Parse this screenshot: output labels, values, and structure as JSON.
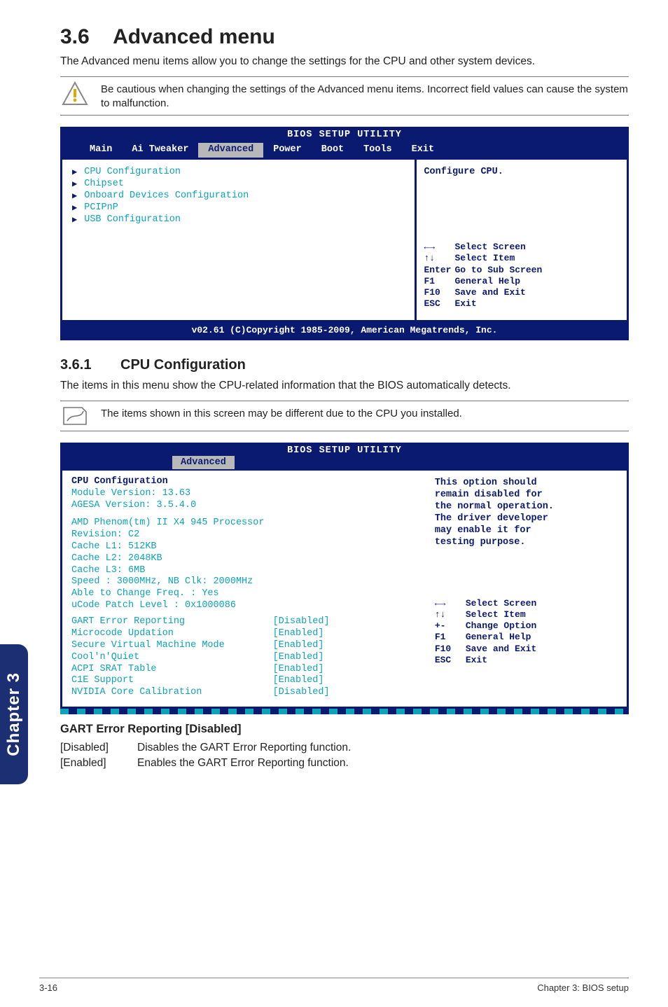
{
  "section": {
    "number": "3.6",
    "title": "Advanced menu"
  },
  "intro": "The Advanced menu items allow you to change the settings for the CPU and other system devices.",
  "warning": "Be cautious when changing the settings of the Advanced menu items. Incorrect field values can cause the system to malfunction.",
  "bios1": {
    "title": "BIOS SETUP UTILITY",
    "tabs": [
      "Main",
      "Ai Tweaker",
      "Advanced",
      "Power",
      "Boot",
      "Tools",
      "Exit"
    ],
    "selected_tab": "Advanced",
    "menu_items": [
      "CPU Configuration",
      "Chipset",
      "Onboard Devices Configuration",
      "PCIPnP",
      "USB Configuration"
    ],
    "help_title": "Configure CPU.",
    "help_keys": [
      {
        "k": "←→",
        "v": "Select Screen"
      },
      {
        "k": "↑↓",
        "v": "Select Item"
      },
      {
        "k": "Enter",
        "v": "Go to Sub Screen"
      },
      {
        "k": "F1",
        "v": "General Help"
      },
      {
        "k": "F10",
        "v": "Save and Exit"
      },
      {
        "k": "ESC",
        "v": "Exit"
      }
    ],
    "footer": "v02.61 (C)Copyright 1985-2009, American Megatrends, Inc."
  },
  "subsection": {
    "number": "3.6.1",
    "title": "CPU Configuration"
  },
  "sub_intro": "The items in this menu show the CPU-related information that the BIOS automatically detects.",
  "note": "The items shown in this screen may be different due to the CPU you installed.",
  "bios2": {
    "title": "BIOS SETUP UTILITY",
    "tab": "Advanced",
    "header": "CPU Configuration",
    "info_lines": [
      "Module Version: 13.63",
      "AGESA Version: 3.5.4.0"
    ],
    "cpu_lines": [
      "AMD Phenom(tm) II X4 945 Processor",
      "Revision: C2",
      "Cache L1: 512KB",
      "Cache L2: 2048KB",
      "Cache L3: 6MB",
      "Speed  : 3000MHz,    NB Clk: 2000MHz",
      "Able to Change Freq.  : Yes",
      "uCode Patch Level     : 0x1000086"
    ],
    "settings": [
      {
        "k": "GART Error Reporting",
        "v": "[Disabled]"
      },
      {
        "k": "Microcode Updation",
        "v": "[Enabled]"
      },
      {
        "k": "Secure Virtual Machine Mode",
        "v": "[Enabled]"
      },
      {
        "k": "Cool'n'Quiet",
        "v": "[Enabled]"
      },
      {
        "k": "ACPI SRAT Table",
        "v": "[Enabled]"
      },
      {
        "k": "C1E Support",
        "v": "[Enabled]"
      },
      {
        "k": "NVIDIA Core Calibration",
        "v": "[Disabled]"
      }
    ],
    "help_text": [
      "This option should",
      "remain disabled for",
      "the normal operation.",
      "The driver developer",
      "may enable it for",
      "testing purpose."
    ],
    "help_keys": [
      {
        "k": "←→",
        "v": "Select Screen"
      },
      {
        "k": "↑↓",
        "v": "Select Item"
      },
      {
        "k": "+-",
        "v": "Change Option"
      },
      {
        "k": "F1",
        "v": "General Help"
      },
      {
        "k": "F10",
        "v": "Save and Exit"
      },
      {
        "k": "ESC",
        "v": "Exit"
      }
    ]
  },
  "gart": {
    "heading": "GART Error Reporting [Disabled]",
    "rows": [
      {
        "l": "[Disabled]",
        "r": "Disables the GART Error Reporting function."
      },
      {
        "l": "[Enabled]",
        "r": "Enables the GART Error Reporting function."
      }
    ]
  },
  "footer": {
    "left": "3-16",
    "right": "Chapter 3: BIOS setup"
  },
  "spine": "Chapter 3"
}
